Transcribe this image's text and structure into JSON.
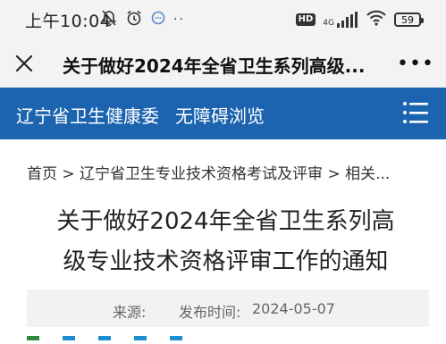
{
  "status_bar": {
    "time": "上午10:04",
    "hd": "HD",
    "network": "4G",
    "battery": "59"
  },
  "title_bar": {
    "title": "关于做好2024年全省卫生系列高级..."
  },
  "site_nav": {
    "site_name": "辽宁省卫生健康委",
    "accessibility": "无障碍浏览"
  },
  "breadcrumb": "首页 > 辽宁省卫生专业技术资格考试及评审 > 相关...",
  "article": {
    "title_line1": "关于做好2024年全省卫生系列高",
    "title_line2": "级专业技术资格评审工作的通知",
    "source_label": "来源:",
    "date_label": "发布时间:",
    "date": "2024-05-07"
  },
  "colors": {
    "nav_bg": "#1c63b0",
    "bar_bg": "#f3f3f3"
  }
}
